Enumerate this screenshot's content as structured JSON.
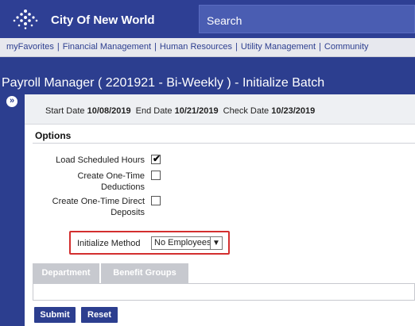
{
  "header": {
    "app_title": "City Of New World",
    "search_placeholder": "Search"
  },
  "nav": {
    "items": [
      "myFavorites",
      "Financial Management",
      "Human Resources",
      "Utility Management",
      "Community"
    ],
    "separator": "|"
  },
  "page": {
    "title": "Payroll Manager ( 2201921 - Bi-Weekly ) - Initialize Batch",
    "expand_icon": "»"
  },
  "dates": {
    "start_label": "Start Date",
    "start_value": "10/08/2019",
    "end_label": "End Date",
    "end_value": "10/21/2019",
    "check_label": "Check Date",
    "check_value": "10/23/2019"
  },
  "options": {
    "title": "Options",
    "load_scheduled_hours": {
      "label": "Load Scheduled Hours",
      "checked": true
    },
    "create_one_time_deductions": {
      "label_line1": "Create One-Time",
      "label_line2": "Deductions",
      "checked": false
    },
    "create_one_time_direct_deposits": {
      "label_line1": "Create One-Time Direct",
      "label_line2": "Deposits",
      "checked": false
    }
  },
  "initialize": {
    "label": "Initialize Method",
    "selected": "No Employees"
  },
  "tabs": [
    {
      "label": "Department"
    },
    {
      "label": "Benefit Groups"
    }
  ],
  "buttons": {
    "submit": "Submit",
    "reset": "Reset"
  },
  "colors": {
    "brand": "#2c3e8f",
    "highlight": "#d32f2f"
  }
}
